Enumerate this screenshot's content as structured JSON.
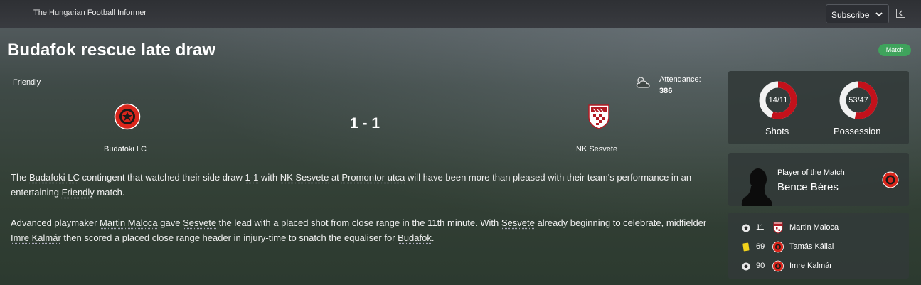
{
  "header": {
    "paper_name": "The Hungarian Football Informer",
    "subscribe_label": "Subscribe",
    "collapse_icon": "collapse-panel-icon"
  },
  "article": {
    "headline": "Budafok rescue late draw",
    "badge": "Match",
    "badge_color": "#3fa35c"
  },
  "match": {
    "competition": "Friendly",
    "weather_icon": "cloudy-icon",
    "attendance_label": "Attendance:",
    "attendance_value": "386",
    "home_team": "Budafoki LC",
    "away_team": "NK Sesvete",
    "score": "1 - 1",
    "home_color": "#d9261c",
    "away_color": "#b31b24"
  },
  "report": {
    "p1": [
      {
        "t": "The "
      },
      {
        "t": "Budafoki LC",
        "link": true
      },
      {
        "t": " contingent that watched their side draw "
      },
      {
        "t": "1-1",
        "link": true
      },
      {
        "t": " with "
      },
      {
        "t": "NK Sesvete",
        "link": true
      },
      {
        "t": " at "
      },
      {
        "t": "Promontor utca",
        "link": true
      },
      {
        "t": " will have been more than pleased with their team's performance in an entertaining "
      },
      {
        "t": "Friendly",
        "link": true
      },
      {
        "t": " match."
      }
    ],
    "p2": [
      {
        "t": "Advanced playmaker "
      },
      {
        "t": "Martin Maloca",
        "link": true
      },
      {
        "t": " gave "
      },
      {
        "t": "Sesvete",
        "link": true
      },
      {
        "t": " the lead with a placed shot from close range in the 11th minute. With "
      },
      {
        "t": "Sesvete",
        "link": true
      },
      {
        "t": " already beginning to celebrate, midfielder "
      },
      {
        "t": "Imre Kalmár",
        "link": true
      },
      {
        "t": " then scored a placed close range header in injury-time to snatch the equaliser for "
      },
      {
        "t": "Budafok",
        "link": true
      },
      {
        "t": "."
      }
    ]
  },
  "stats": {
    "shots": {
      "label": "Shots",
      "value": "14/11",
      "home": 14,
      "away": 11
    },
    "possession": {
      "label": "Possession",
      "value": "53/47",
      "home": 53,
      "away": 47
    }
  },
  "player_of_match": {
    "title": "Player of the Match",
    "name": "Bence Béres"
  },
  "events": [
    {
      "icon": "football-icon",
      "minute": "11",
      "team": "away",
      "player": "Martin Maloca"
    },
    {
      "icon": "yellow-card-icon",
      "minute": "69",
      "team": "home",
      "player": "Tamás Kállai"
    },
    {
      "icon": "football-icon",
      "minute": "90",
      "team": "home",
      "player": "Imre Kalmár"
    }
  ]
}
